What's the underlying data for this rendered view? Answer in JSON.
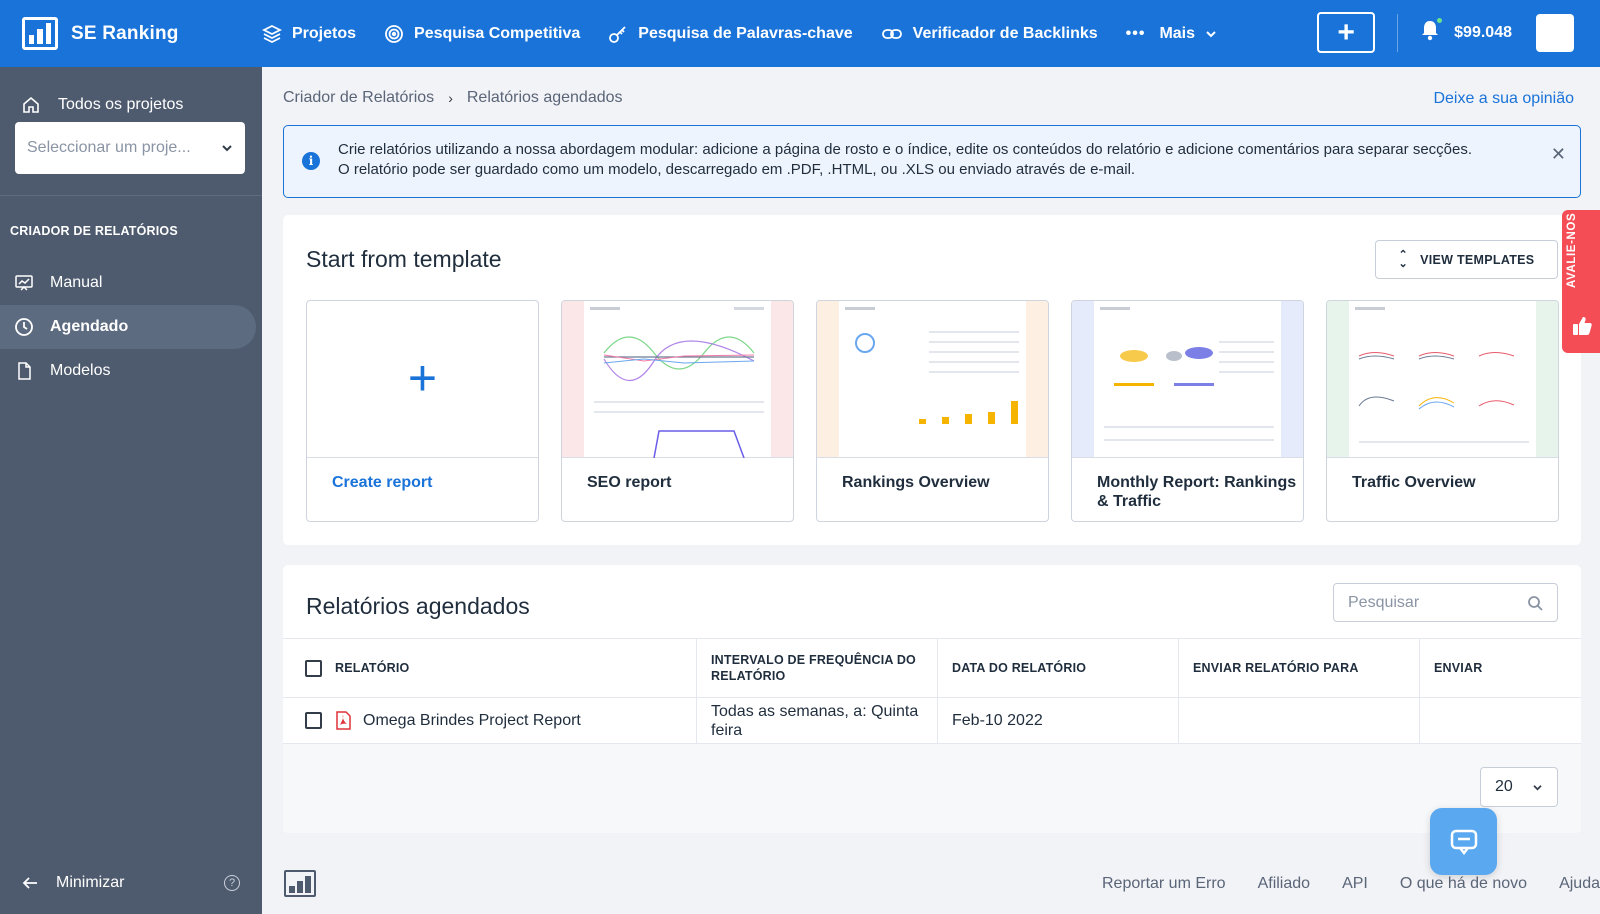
{
  "brand": {
    "name": "SE Ranking"
  },
  "topnav": {
    "items": [
      {
        "label": "Projetos",
        "icon": "layers-icon"
      },
      {
        "label": "Pesquisa Competitiva",
        "icon": "target-icon"
      },
      {
        "label": "Pesquisa de Palavras-chave",
        "icon": "key-icon"
      },
      {
        "label": "Verificador de Backlinks",
        "icon": "link-icon"
      }
    ],
    "more_label": "Mais",
    "balance": "$99.048"
  },
  "sidebar": {
    "all_projects": "Todos os projetos",
    "project_select_placeholder": "Seleccionar um proje...",
    "section_title": "CRIADOR DE RELATÓRIOS",
    "items": [
      {
        "label": "Manual"
      },
      {
        "label": "Agendado"
      },
      {
        "label": "Modelos"
      }
    ],
    "minimize_label": "Minimizar"
  },
  "breadcrumb": {
    "parent": "Criador de Relatórios",
    "current": "Relatórios agendados"
  },
  "feedback_link": "Deixe a sua opinião",
  "info": {
    "line1": "Crie relatórios utilizando a nossa abordagem modular: adicione a página de rosto e o índice, edite os conteúdos do relatório e adicione comentários para separar secções.",
    "line2": "O relatório pode ser guardado como um modelo, descarregado em .PDF, .HTML, ou .XLS ou enviado através de e-mail."
  },
  "templates": {
    "title": "Start from template",
    "view_button": "VIEW TEMPLATES",
    "items": [
      {
        "name": "Create report"
      },
      {
        "name": "SEO report"
      },
      {
        "name": "Rankings Overview"
      },
      {
        "name": "Monthly Report: Rankings & Traffic"
      },
      {
        "name": "Traffic Overview"
      }
    ]
  },
  "scheduled": {
    "title": "Relatórios agendados",
    "search_placeholder": "Pesquisar",
    "columns": [
      "RELATÓRIO",
      "INTERVALO DE FREQUÊNCIA DO RELATÓRIO",
      "DATA DO RELATÓRIO",
      "ENVIAR RELATÓRIO PARA",
      "ENVIAR"
    ],
    "rows": [
      {
        "report": "Omega Brindes Project Report",
        "frequency": "Todas as semanas, a: Quinta feira",
        "date": "Feb-10 2022",
        "send_to": "",
        "send": ""
      }
    ],
    "per_page": "20"
  },
  "footer": {
    "links": [
      "Reportar um Erro",
      "Afiliado",
      "API",
      "O que há de novo",
      "Ajuda"
    ]
  },
  "rate_tab": "AVALIE-NOS",
  "colors": {
    "primary": "#1a73d9",
    "sidebar": "#4e5b6e",
    "rate": "#f44d55",
    "chat": "#5aa8f0"
  }
}
